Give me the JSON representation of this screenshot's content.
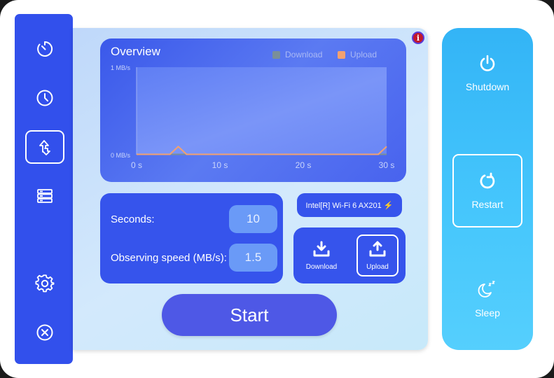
{
  "sidebar": {
    "items": [
      {
        "icon": "timer-icon"
      },
      {
        "icon": "clock-icon"
      },
      {
        "icon": "transfer-icon"
      },
      {
        "icon": "storage-icon"
      },
      {
        "icon": "gear-icon"
      },
      {
        "icon": "close-icon"
      }
    ]
  },
  "overview": {
    "title": "Overview",
    "legend": {
      "download": "Download",
      "upload": "Upload"
    }
  },
  "chart_data": {
    "type": "line",
    "title": "Overview",
    "x": [
      0,
      1,
      2,
      3,
      4,
      5,
      6,
      7,
      8,
      9,
      10,
      11,
      12,
      13,
      14,
      15,
      16,
      17,
      18,
      19,
      20,
      21,
      22,
      23,
      24,
      25,
      26,
      27,
      28,
      29,
      30
    ],
    "xticks": [
      "0 s",
      "10 s",
      "20 s",
      "30 s"
    ],
    "xlim": [
      0,
      30
    ],
    "yticks": [
      "1 MB/s",
      "0 MB/s"
    ],
    "ylim": [
      0,
      1
    ],
    "series": [
      {
        "name": "Download",
        "color": "#7a8f99",
        "values": [
          0,
          0,
          0,
          0,
          0,
          0,
          0,
          0,
          0,
          0,
          0,
          0,
          0,
          0,
          0,
          0,
          0,
          0,
          0,
          0,
          0,
          0,
          0,
          0,
          0,
          0,
          0,
          0,
          0,
          0,
          0
        ]
      },
      {
        "name": "Upload",
        "color": "#f2a170",
        "values": [
          0,
          0,
          0,
          0,
          0,
          0.09,
          0,
          0,
          0,
          0,
          0,
          0,
          0,
          0,
          0,
          0,
          0,
          0,
          0,
          0,
          0,
          0,
          0,
          0,
          0,
          0,
          0,
          0,
          0,
          0,
          0.09
        ]
      }
    ],
    "legend": "top-right",
    "grid": false
  },
  "params": {
    "seconds_label": "Seconds:",
    "seconds_value": "10",
    "speed_label": "Observing speed (MB/s):",
    "speed_value": "1.5"
  },
  "adapter": {
    "label": "Intel[R] Wi-Fi 6 AX201 ⚡"
  },
  "mode": {
    "download": "Download",
    "upload": "Upload"
  },
  "start_label": "Start",
  "power": {
    "shutdown": "Shutdown",
    "restart": "Restart",
    "sleep": "Sleep"
  },
  "colors": {
    "sidebar": "#3250ec",
    "panel": "#3654ec",
    "power_panel": "#45c6fc",
    "start": "#4e58e6",
    "info": "#c2182b"
  }
}
